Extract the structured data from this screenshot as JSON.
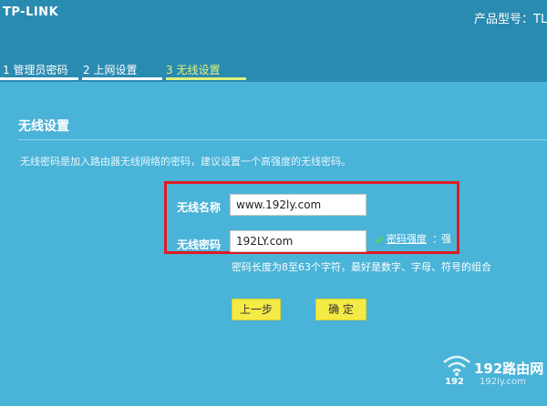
{
  "header": {
    "brand": "TP-LINK",
    "model_label": "产品型号：TL-W"
  },
  "steps": [
    {
      "label": "1 管理员密码",
      "active": false
    },
    {
      "label": "2 上网设置",
      "active": false
    },
    {
      "label": "3 无线设置",
      "active": true
    }
  ],
  "wireless": {
    "title": "无线设置",
    "description": "无线密码是加入路由器无线网络的密码，建议设置一个高强度的无线密码。",
    "ssid_label": "无线名称",
    "ssid_value": "www.192ly.com",
    "password_label": "无线密码",
    "password_value": "192LY.com",
    "strength_label": "密码强度",
    "strength_sep": "：",
    "strength_value": "强",
    "hint": "密码长度为8至63个字符，最好是数字、字母、符号的组合"
  },
  "buttons": {
    "prev": "上一步",
    "confirm": "确 定"
  },
  "watermark": {
    "title": "192路由网",
    "subtitle": "192ly.com",
    "mini": "192"
  },
  "colors": {
    "background": "#4ab3d8",
    "header": "#2a8bb1",
    "accent": "#dff07a",
    "button": "#f3ea46",
    "highlight": "#e01b22"
  }
}
